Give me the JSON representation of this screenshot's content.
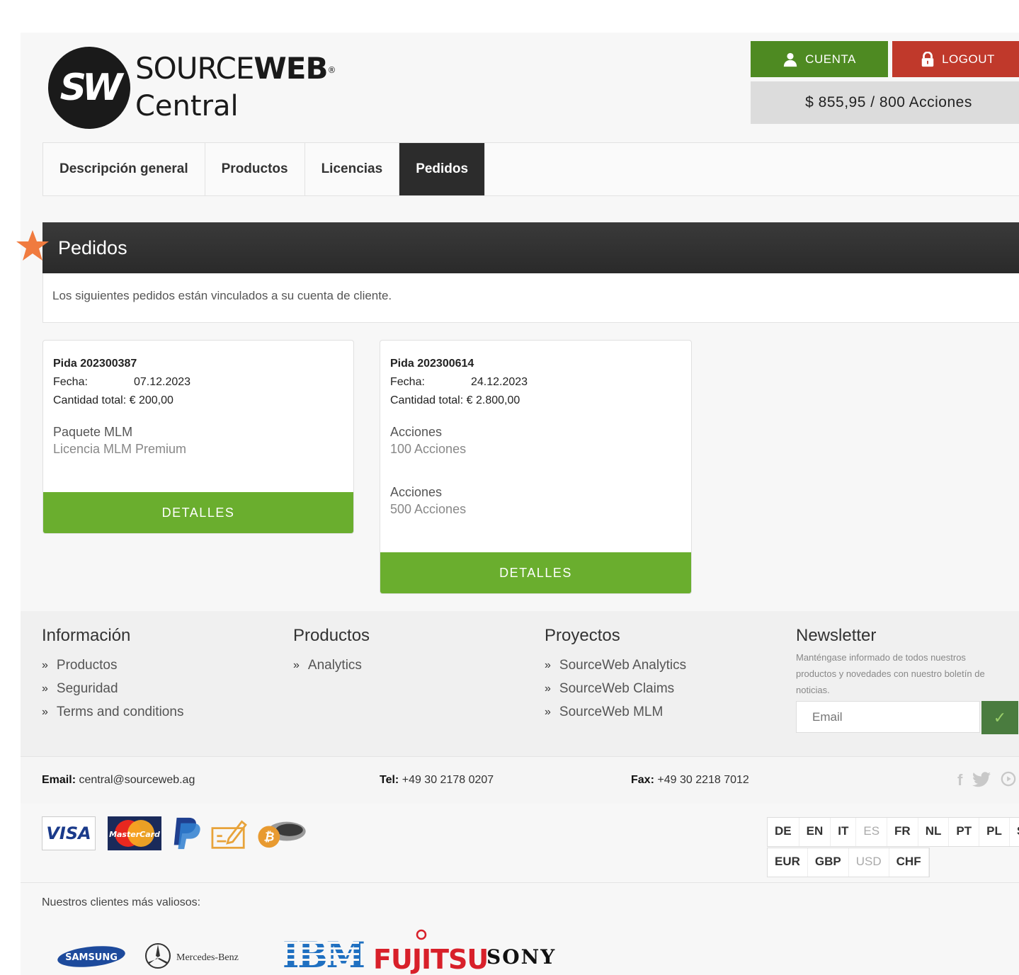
{
  "brand": {
    "name_light": "SOURCE",
    "name_bold": "WEB",
    "registered": "®",
    "sub": "Central",
    "mark": "SW"
  },
  "header": {
    "account_label": "CUENTA",
    "logout_label": "LOGOUT",
    "balance": "$ 855,95 / 800 Acciones"
  },
  "nav": {
    "tabs": [
      {
        "label": "Descripción general"
      },
      {
        "label": "Productos"
      },
      {
        "label": "Licencias"
      },
      {
        "label": "Pedidos",
        "active": true
      }
    ]
  },
  "panel": {
    "title": "Pedidos",
    "description": "Los siguientes pedidos están vinculados a su cuenta de cliente."
  },
  "orders": [
    {
      "title": "Pida 202300387",
      "date_label": "Fecha:",
      "date": "07.12.2023",
      "total_label": "Cantidad total:",
      "total": "€ 200,00",
      "items": [
        {
          "name": "Paquete MLM",
          "sub": "Licencia MLM Premium"
        }
      ],
      "button": "DETALLES"
    },
    {
      "title": "Pida 202300614",
      "date_label": "Fecha:",
      "date": "24.12.2023",
      "total_label": "Cantidad total:",
      "total": "€ 2.800,00",
      "items": [
        {
          "name": "Acciones",
          "sub": "100 Acciones"
        },
        {
          "name": "Acciones",
          "sub": "500 Acciones"
        }
      ],
      "button": "DETALLES"
    }
  ],
  "footer": {
    "info": {
      "title": "Información",
      "links": [
        "Productos",
        "Seguridad",
        "Terms and conditions"
      ]
    },
    "products": {
      "title": "Productos",
      "links": [
        "Analytics"
      ]
    },
    "projects": {
      "title": "Proyectos",
      "links": [
        "SourceWeb Analytics",
        "SourceWeb Claims",
        "SourceWeb MLM"
      ]
    },
    "newsletter": {
      "title": "Newsletter",
      "text": "Manténgase informado de todos nuestros productos y novedades con nuestro boletín de noticias.",
      "placeholder": "Email",
      "submit": "✓"
    },
    "contact": {
      "email_label": "Email:",
      "email": "central@sourceweb.ag",
      "tel_label": "Tel:",
      "tel": "+49 30 2178 0207",
      "fax_label": "Fax:",
      "fax": "+49 30 2218 7012"
    },
    "payments": {
      "visa": "VISA",
      "mastercard": "MasterCard"
    },
    "languages": [
      "DE",
      "EN",
      "IT",
      "ES",
      "FR",
      "NL",
      "PT",
      "PL",
      "SV"
    ],
    "active_language": "ES",
    "currencies": [
      "EUR",
      "GBP",
      "USD",
      "CHF"
    ],
    "active_currency": "USD",
    "clients_label": "Nuestros clientes más valiosos:",
    "clients": [
      "SAMSUNG",
      "Mercedes-Benz",
      "IBM",
      "FUJITSU",
      "SONY"
    ]
  },
  "colors": {
    "account_green": "#4e8a22",
    "logout_red": "#c0392b",
    "details_green": "#6aae2e",
    "dark_header": "#2c2c2c",
    "star_orange": "#f07b3f"
  }
}
